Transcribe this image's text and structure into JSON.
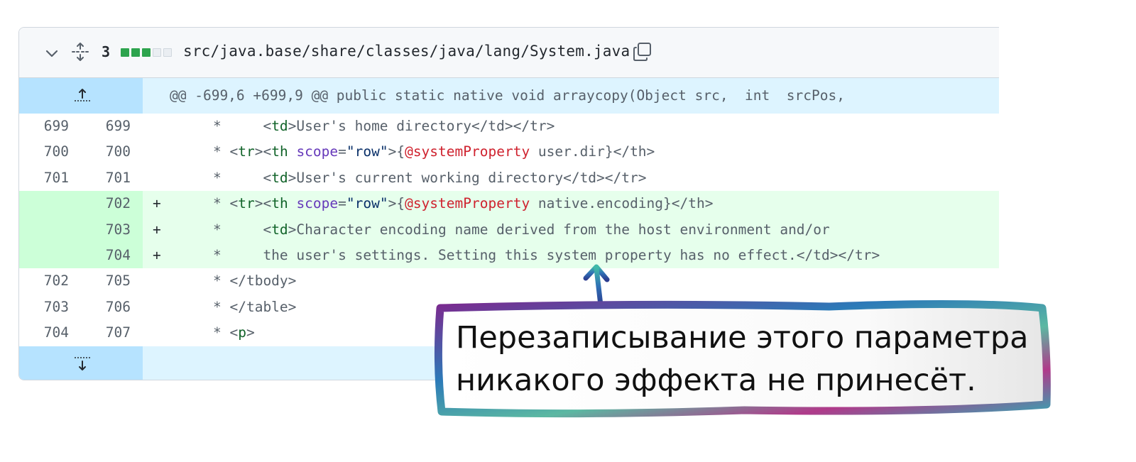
{
  "file_header": {
    "changes_count": "3",
    "stat_blocks": [
      "add",
      "add",
      "add",
      "neutral",
      "neutral"
    ],
    "file_path": "src/java.base/share/classes/java/lang/System.java"
  },
  "hunk_header": "@@ -699,6 +699,9 @@ public static native void arraycopy(Object src,  int  srcPos,",
  "rows": [
    {
      "old": "699",
      "new": "699",
      "marker": "",
      "type": "context",
      "tokens": [
        [
          "plain",
          "*     <"
        ],
        [
          "tag",
          "td"
        ],
        [
          "plain",
          ">User's home directory</td></tr>"
        ]
      ]
    },
    {
      "old": "700",
      "new": "700",
      "marker": "",
      "type": "context",
      "tokens": [
        [
          "plain",
          "* <"
        ],
        [
          "tag",
          "tr"
        ],
        [
          "plain",
          "><"
        ],
        [
          "tag",
          "th"
        ],
        [
          "plain",
          " "
        ],
        [
          "attr",
          "scope"
        ],
        [
          "plain",
          "="
        ],
        [
          "str",
          "\"row\""
        ],
        [
          "plain",
          ">{"
        ],
        [
          "ann",
          "@systemProperty"
        ],
        [
          "plain",
          " user.dir}</th>"
        ]
      ]
    },
    {
      "old": "701",
      "new": "701",
      "marker": "",
      "type": "context",
      "tokens": [
        [
          "plain",
          "*     <"
        ],
        [
          "tag",
          "td"
        ],
        [
          "plain",
          ">User's current working directory</td></tr>"
        ]
      ]
    },
    {
      "old": "",
      "new": "702",
      "marker": "+",
      "type": "added",
      "tokens": [
        [
          "plain",
          "* <"
        ],
        [
          "tag",
          "tr"
        ],
        [
          "plain",
          "><"
        ],
        [
          "tag",
          "th"
        ],
        [
          "plain",
          " "
        ],
        [
          "attr",
          "scope"
        ],
        [
          "plain",
          "="
        ],
        [
          "str",
          "\"row\""
        ],
        [
          "plain",
          ">{"
        ],
        [
          "ann",
          "@systemProperty"
        ],
        [
          "plain",
          " native.encoding}</th>"
        ]
      ]
    },
    {
      "old": "",
      "new": "703",
      "marker": "+",
      "type": "added",
      "tokens": [
        [
          "plain",
          "*     <"
        ],
        [
          "tag",
          "td"
        ],
        [
          "plain",
          ">Character encoding name derived from the host environment and/or"
        ]
      ]
    },
    {
      "old": "",
      "new": "704",
      "marker": "+",
      "type": "added",
      "tokens": [
        [
          "plain",
          "*     the user's settings. Setting this system property has no effect.</td></tr>"
        ]
      ]
    },
    {
      "old": "702",
      "new": "705",
      "marker": "",
      "type": "context",
      "tokens": [
        [
          "plain",
          "* </tbody>"
        ]
      ]
    },
    {
      "old": "703",
      "new": "706",
      "marker": "",
      "type": "context",
      "tokens": [
        [
          "plain",
          "* </table>"
        ]
      ]
    },
    {
      "old": "704",
      "new": "707",
      "marker": "",
      "type": "context",
      "tokens": [
        [
          "plain",
          "* <"
        ],
        [
          "tag",
          "p"
        ],
        [
          "plain",
          ">"
        ]
      ]
    }
  ],
  "callout": {
    "text": "Перезаписывание этого параметра\nникакого эффекта не принесёт."
  },
  "icons": {
    "collapse": "chevron-down-icon",
    "expand_all": "unfold-icon",
    "copy": "copy-icon",
    "expand_up": "expand-up-icon",
    "expand_down": "expand-down-icon"
  },
  "colors": {
    "added_bg": "#e6ffec",
    "added_gutter": "#ccffd8",
    "hunk_bg": "#ddf4ff",
    "hunk_gutter": "#b6e3ff",
    "stat_add": "#2da44e"
  }
}
